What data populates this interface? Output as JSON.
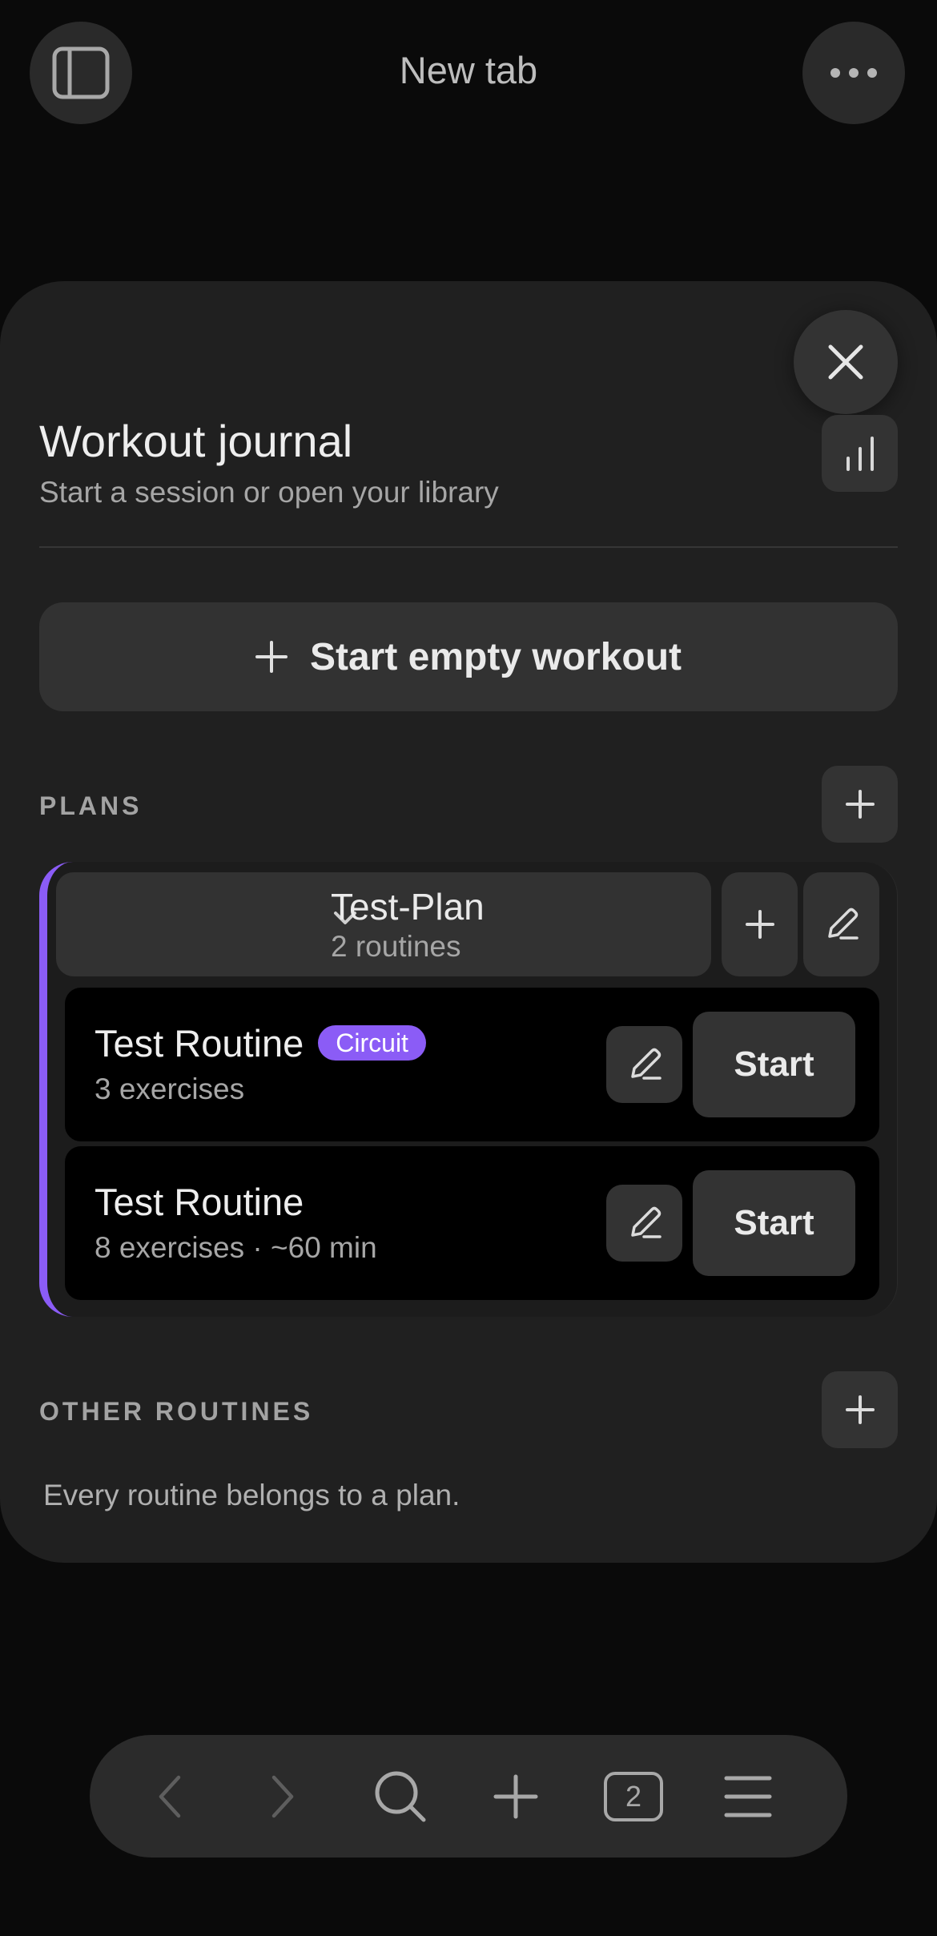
{
  "browser": {
    "tab_title": "New tab",
    "tab_count": "2",
    "icons": [
      "sidebar-icon",
      "more-icon",
      "back-icon",
      "forward-icon",
      "search-icon",
      "new-tab-icon",
      "menu-icon"
    ]
  },
  "sheet": {
    "title": "Workout journal",
    "subtitle": "Start a session or open your library",
    "start_empty_label": "Start empty workout",
    "plans_label": "PLANS",
    "other_routines_label": "OTHER ROUTINES",
    "other_routines_empty": "Every routine belongs to a plan."
  },
  "plan": {
    "name": "Test-Plan",
    "count": "2 routines",
    "accent": "#8b5cf6",
    "routines": [
      {
        "name": "Test Routine",
        "badge": "Circuit",
        "meta": "3 exercises",
        "start_label": "Start"
      },
      {
        "name": "Test Routine",
        "meta": "8 exercises · ~60 min",
        "start_label": "Start"
      }
    ]
  }
}
